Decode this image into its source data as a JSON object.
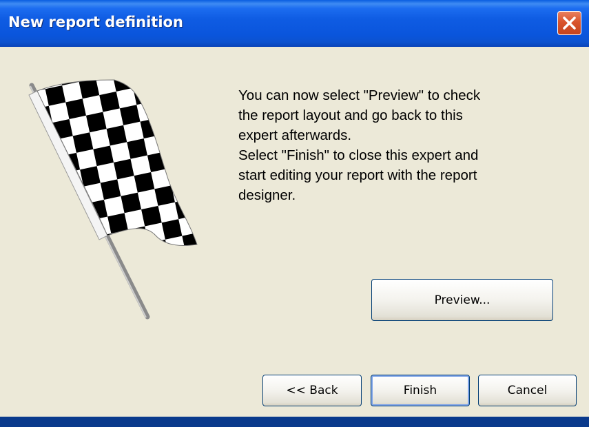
{
  "window": {
    "title": "New report definition"
  },
  "message": {
    "lines": [
      "You can now select \"Preview\" to check",
      "the report layout and go back to this",
      "expert afterwards.",
      "Select \"Finish\" to close this expert and",
      "start editing your report with the report",
      "designer."
    ]
  },
  "buttons": {
    "preview": "Preview...",
    "back": "<< Back",
    "finish": "Finish",
    "cancel": "Cancel"
  },
  "icons": {
    "close": "close-icon",
    "flag": "checkered-flag-icon"
  },
  "colors": {
    "titlebar": "#0a55dc",
    "dialog_background": "#ece9d8",
    "close_button": "#d9542c"
  }
}
